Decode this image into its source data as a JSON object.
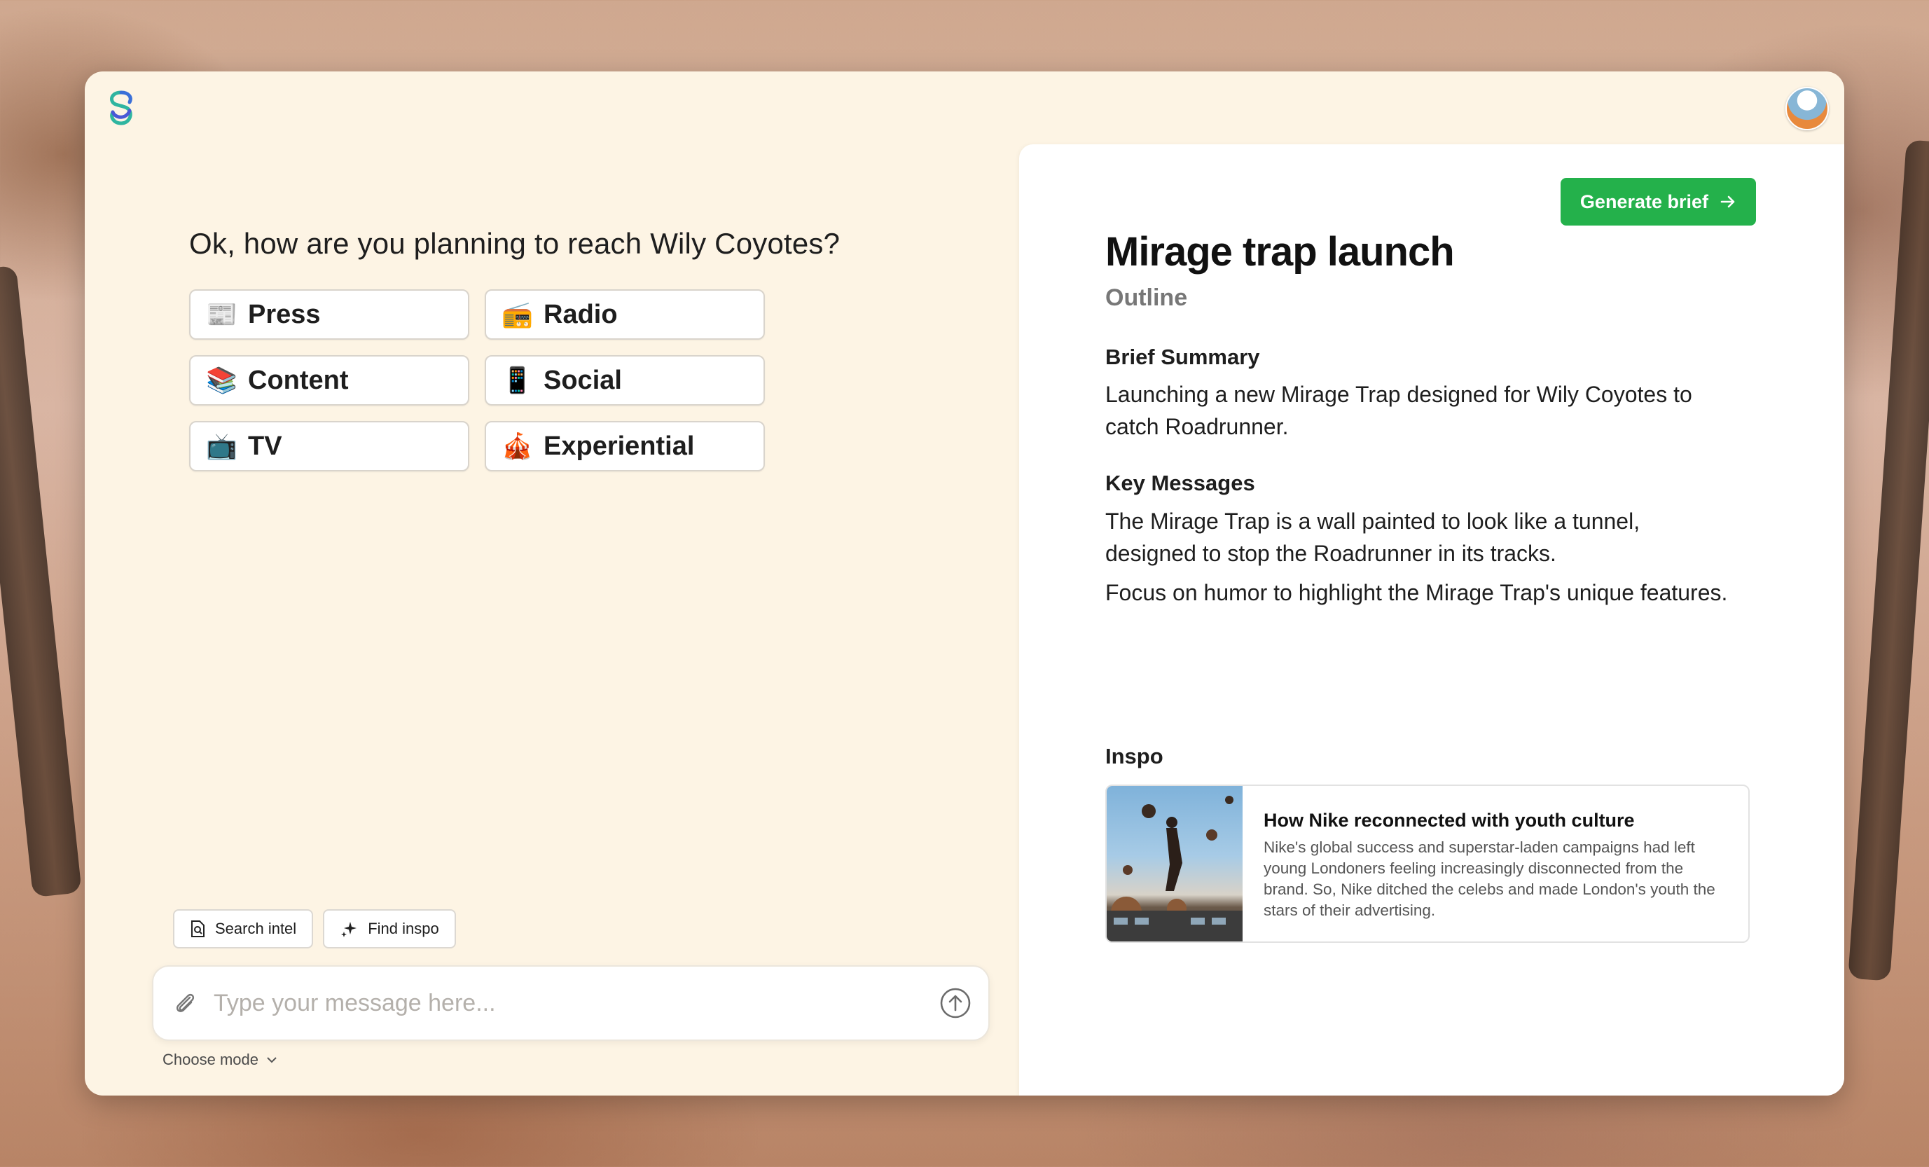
{
  "chat": {
    "question": "Ok, how are you planning to reach Wily Coyotes?",
    "options": [
      {
        "emoji": "📰",
        "label": "Press"
      },
      {
        "emoji": "📻",
        "label": "Radio"
      },
      {
        "emoji": "📚",
        "label": "Content"
      },
      {
        "emoji": "📱",
        "label": "Social"
      },
      {
        "emoji": "📺",
        "label": "TV"
      },
      {
        "emoji": "🎪",
        "label": "Experiential"
      }
    ],
    "tools": {
      "search_intel": "Search intel",
      "find_inspo": "Find inspo"
    },
    "composer": {
      "placeholder": "Type your message here..."
    },
    "mode_label": "Choose mode"
  },
  "brief": {
    "generate_label": "Generate brief",
    "title": "Mirage trap launch",
    "subtitle": "Outline",
    "summary_heading": "Brief Summary",
    "summary_text": "Launching a new Mirage Trap designed for Wily Coyotes to catch Roadrunner.",
    "key_messages_heading": "Key Messages",
    "key_messages": [
      "The Mirage Trap is a wall painted to look like a tunnel, designed to stop the Roadrunner in its tracks.",
      "Focus on humor to highlight the Mirage Trap's unique features."
    ],
    "inspo_heading": "Inspo",
    "inspo_card": {
      "title": "How Nike reconnected with youth culture",
      "description": "Nike's global success and superstar-laden campaigns had left young Londoners feeling increasingly disconnected from the brand. So, Nike ditched the celebs and made London's youth the stars of their advertising."
    }
  },
  "colors": {
    "window_bg": "#fdf4e4",
    "accent_green": "#24b14b"
  }
}
